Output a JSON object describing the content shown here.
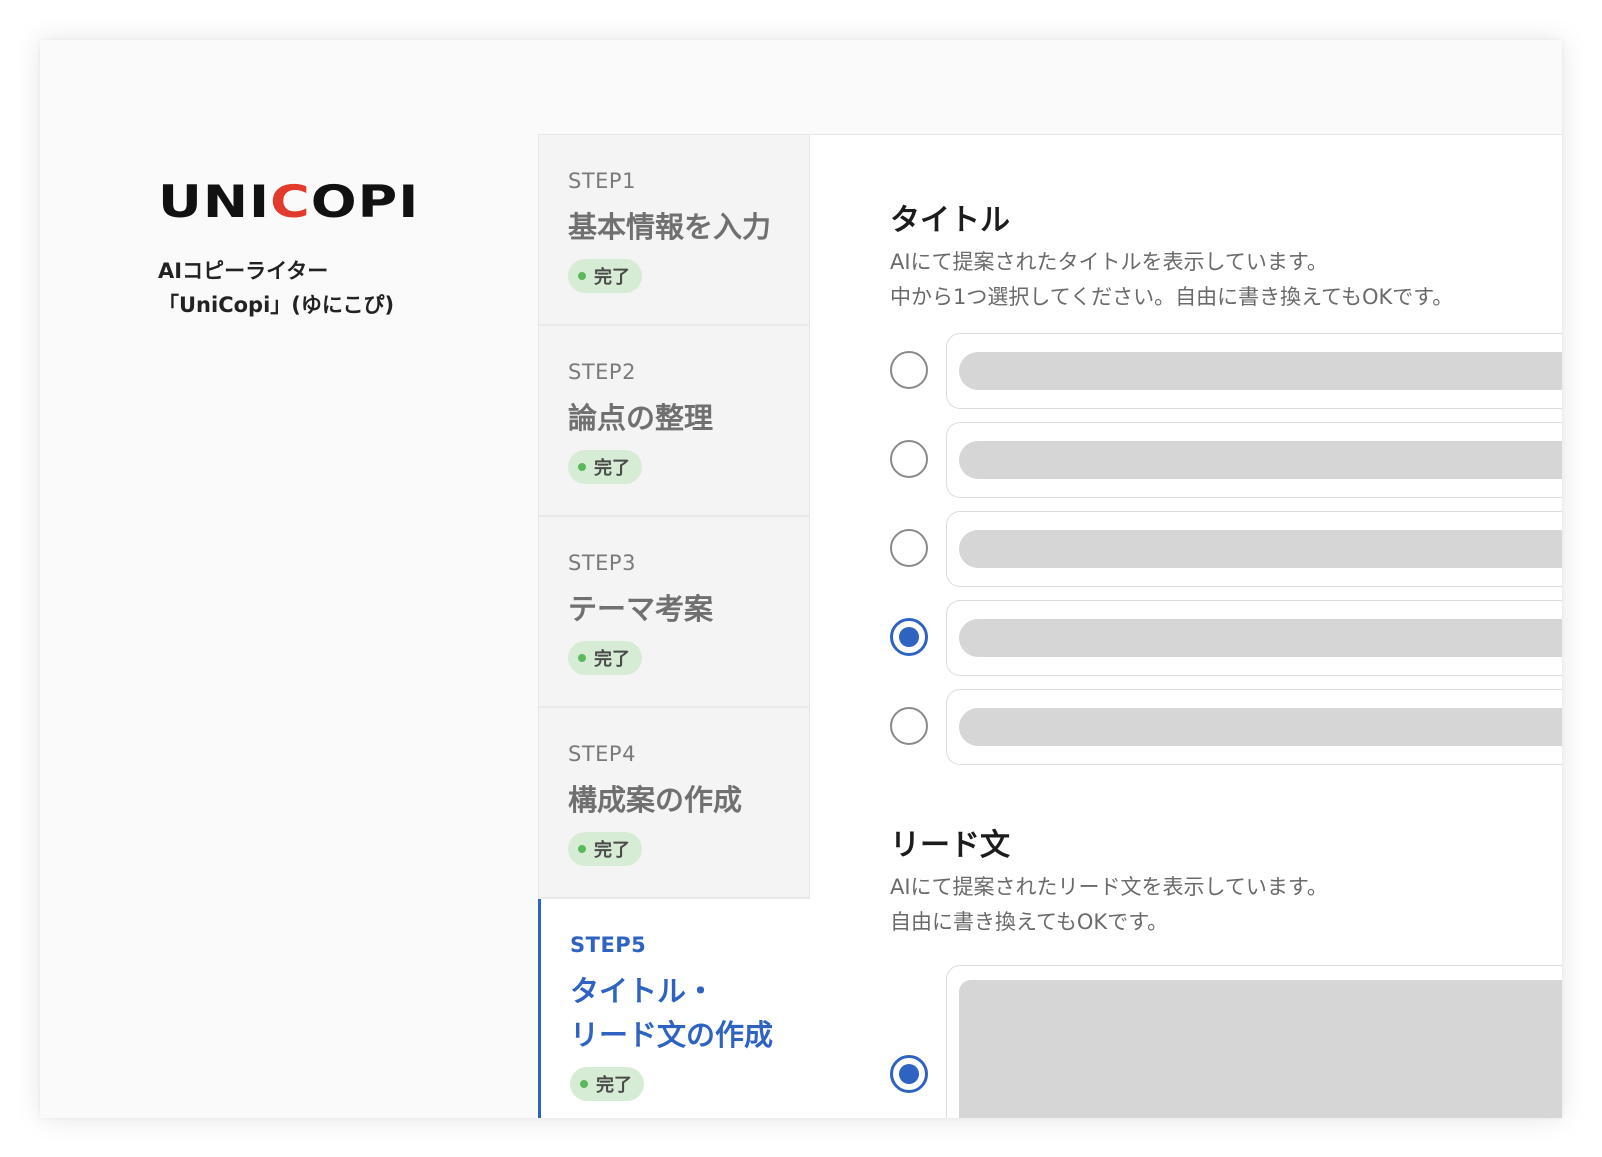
{
  "brand": {
    "logo_primary": "UNI",
    "logo_accent": "C",
    "logo_rest": "OPI",
    "tagline_line1": "AIコピーライター",
    "tagline_line2": "「UniCopi」(ゆにこぴ)"
  },
  "steps": [
    {
      "number": "STEP1",
      "title_lines": [
        "基本情報を入力"
      ],
      "status": "完了",
      "active": false
    },
    {
      "number": "STEP2",
      "title_lines": [
        "論点の整理"
      ],
      "status": "完了",
      "active": false
    },
    {
      "number": "STEP3",
      "title_lines": [
        "テーマ考案"
      ],
      "status": "完了",
      "active": false
    },
    {
      "number": "STEP4",
      "title_lines": [
        "構成案の作成"
      ],
      "status": "完了",
      "active": false
    },
    {
      "number": "STEP5",
      "title_lines": [
        "タイトル・",
        "リード文の作成"
      ],
      "status": "完了",
      "active": true
    }
  ],
  "title_section": {
    "heading": "タイトル",
    "desc_line1": "AIにて提案されたタイトルを表示しています。",
    "desc_line2": "中から1つ選択してください。自由に書き換えてもOKです。",
    "options": [
      {
        "selected": false
      },
      {
        "selected": false
      },
      {
        "selected": false
      },
      {
        "selected": true
      },
      {
        "selected": false
      }
    ]
  },
  "lead_section": {
    "heading": "リード文",
    "desc_line1": "AIにて提案されたリード文を表示しています。",
    "desc_line2": "自由に書き換えてもOKです。",
    "selected": true
  },
  "colors": {
    "accent": "#2f63c2",
    "logo_red": "#e23b2e",
    "done_badge_bg": "#d7ecd4",
    "done_dot": "#5cb85c",
    "placeholder": "#d6d6d6"
  }
}
